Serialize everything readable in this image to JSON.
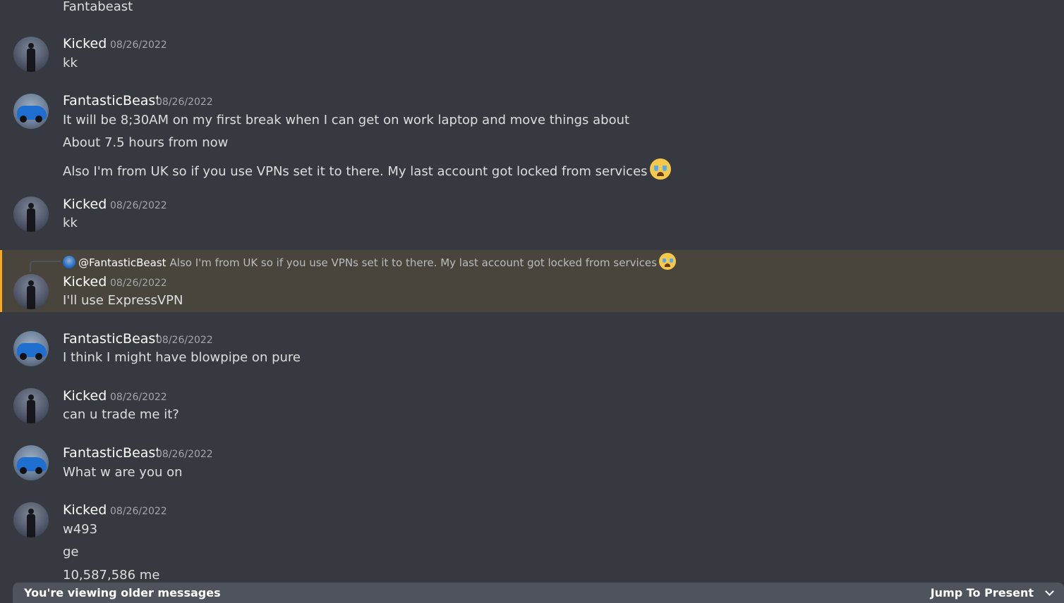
{
  "top_partial": "Fantabeast",
  "messages": [
    {
      "author": "Kicked",
      "timestamp": "08/26/2022",
      "lines": [
        "kk"
      ]
    },
    {
      "author": "FantasticBeast",
      "timestamp": "08/26/2022",
      "lines": [
        "It will be 8;30AM on my first break when I can get on work laptop and move things about",
        "About 7.5 hours from now",
        "Also I'm from UK so if you use VPNs set it to there. My last account got locked from services"
      ],
      "emoji": "loudly-crying-face"
    },
    {
      "author": "Kicked",
      "timestamp": "08/26/2022",
      "lines": [
        "kk"
      ]
    },
    {
      "author": "Kicked",
      "timestamp": "08/26/2022",
      "lines": [
        "I'll use ExpressVPN"
      ],
      "reply_to": {
        "mention": "@FantasticBeast",
        "text": "Also I'm from UK so if you use VPNs set it to there. My last account got locked from services"
      }
    },
    {
      "author": "FantasticBeast",
      "timestamp": "08/26/2022",
      "lines": [
        "I think I might have blowpipe on pure"
      ]
    },
    {
      "author": "Kicked",
      "timestamp": "08/26/2022",
      "lines": [
        "can u trade me it?"
      ]
    },
    {
      "author": "FantasticBeast",
      "timestamp": "08/26/2022",
      "lines": [
        "What w are you on"
      ]
    },
    {
      "author": "Kicked",
      "timestamp": "08/26/2022",
      "lines": [
        "w493",
        "ge",
        "10,587,586 me"
      ]
    }
  ],
  "footer": {
    "older_text": "You're viewing older messages",
    "jump_label": "Jump To Present"
  },
  "colors": {
    "background": "#36393f",
    "highlight": "#49443c",
    "highlight_border": "#faa81a",
    "bar": "#4f545c"
  }
}
